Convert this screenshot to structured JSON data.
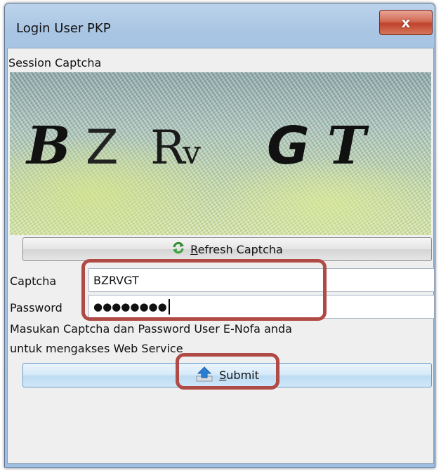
{
  "window": {
    "title": "Login User PKP",
    "close_label": "x"
  },
  "session": {
    "label": "Session Captcha",
    "captcha_text": [
      "B",
      "Z",
      "R",
      "v",
      "G",
      "T"
    ]
  },
  "refresh_button": {
    "label_first": "R",
    "label_rest": "efresh Captcha",
    "icon": "refresh-arrows-icon"
  },
  "form": {
    "captcha_label": "Captcha",
    "captcha_value": "BZRVGT",
    "password_label": "Password",
    "password_value": "●●●●●●●●"
  },
  "info": {
    "line1": "Masukan Captcha dan Password User E-Nofa anda",
    "line2": "untuk mengakses Web Service"
  },
  "submit_button": {
    "label_first": "S",
    "label_rest": "ubmit",
    "icon": "upload-arrow-icon"
  },
  "colors": {
    "highlight": "#b04a45",
    "refresh_icon": "#2e8b2e",
    "submit_icon": "#2a7fd4"
  }
}
